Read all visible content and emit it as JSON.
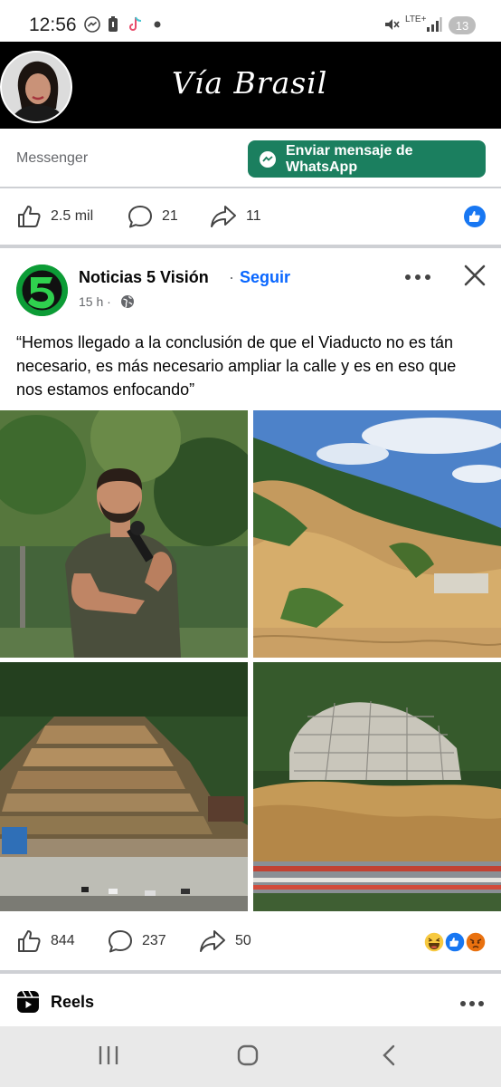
{
  "status_bar": {
    "time": "12:56",
    "network": "LTE+",
    "battery_level": "13",
    "icons": [
      "messenger-icon",
      "battery-saver-icon",
      "tiktok-icon",
      "dot-icon",
      "mute-icon",
      "signal-icon"
    ]
  },
  "cover": {
    "title": "Vía Brasil"
  },
  "messenger_row": {
    "messenger_label": "Messenger",
    "whatsapp_button_label": "Enviar mensaje de WhatsApp"
  },
  "prev_post_actions": {
    "likes": "2.5 mil",
    "comments": "21",
    "shares": "11"
  },
  "post": {
    "author": "Noticias 5 Visión",
    "separator": "·",
    "follow_label": "Seguir",
    "time": "15 h ·",
    "text": "“Hemos llegado a la conclusión de que el Viaducto no es tán necesario, es más necesario ampliar la calle y es en eso que nos estamos enfocando”",
    "actions": {
      "likes": "844",
      "comments": "237",
      "shares": "50"
    },
    "reactions": [
      "haha-icon",
      "like-icon",
      "angry-icon"
    ]
  },
  "reels": {
    "label": "Reels"
  },
  "colors": {
    "whatsapp_green": "#1b7f5f",
    "link_blue": "#0866ff",
    "cover_black": "#000000",
    "divider": "#ced0d4"
  }
}
